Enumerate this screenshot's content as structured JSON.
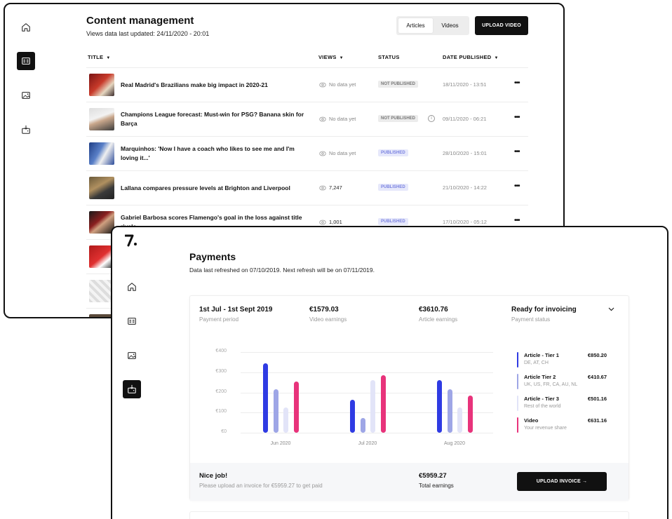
{
  "content_management": {
    "title": "Content management",
    "last_updated": "Views data last updated: 24/11/2020 - 20:01",
    "tabs": [
      "Articles",
      "Videos"
    ],
    "active_tab": "Articles",
    "upload_video_label": "UPLOAD VIDEO",
    "columns": {
      "title": "TITLE",
      "views": "VIEWS",
      "status": "STATUS",
      "date": "DATE PUBLISHED"
    },
    "rows": [
      {
        "title": "Real Madrid's Brazilians make big impact in 2020-21",
        "views": "No data yet",
        "status": "NOT PUBLISHED",
        "date": "18/11/2020 - 13:51"
      },
      {
        "title": "Champions League forecast: Must-win for PSG? Banana skin for Barça",
        "views": "No data yet",
        "status": "NOT PUBLISHED",
        "date": "09/11/2020 - 06:21"
      },
      {
        "title": "Marquinhos: 'Now I have a coach who likes to see me and I'm loving it...'",
        "views": "No data yet",
        "status": "PUBLISHED",
        "date": "28/10/2020 - 15:01"
      },
      {
        "title": "Lallana compares pressure levels at Brighton and Liverpool",
        "views": "7,247",
        "status": "PUBLISHED",
        "date": "21/10/2020 - 14:22"
      },
      {
        "title": "Gabriel Barbosa scores Flamengo's goal in the loss against title rivals",
        "views": "1,001",
        "status": "PUBLISHED",
        "date": "17/10/2020 - 05:12"
      }
    ],
    "more_icon": "more-horizontal-icon"
  },
  "payments": {
    "logo": "7",
    "title": "Payments",
    "subtitle": "Data last refreshed on 07/10/2019. Next refresh will be on 07/11/2019.",
    "summary": [
      {
        "value": "1st Jul - 1st Sept 2019",
        "label": "Payment period"
      },
      {
        "value": "€1579.03",
        "label": "Video earnings"
      },
      {
        "value": "€3610.76",
        "label": "Article earnings"
      },
      {
        "value": "Ready for invoicing",
        "label": "Payment status"
      }
    ],
    "legend": [
      {
        "name": "Article - Tier 1",
        "sub": "DE, AT, CH",
        "amount": "€850.20"
      },
      {
        "name": "Article Tier 2",
        "sub": "UK, US, FR, CA, AU, NL",
        "amount": "€410.67"
      },
      {
        "name": "Article - Tier 3",
        "sub": "Rest of the world",
        "amount": "€501.16"
      },
      {
        "name": "Video",
        "sub": "Your revenue share",
        "amount": "€631.16"
      }
    ],
    "footer": {
      "heading": "Nice job!",
      "message": "Please upload an invoice for €5959.27 to get paid",
      "total": "€5959.27",
      "total_label": "Total earnings",
      "button": "UPLOAD INVOICE →"
    }
  },
  "chart_data": {
    "type": "bar",
    "categories": [
      "Jun 2020",
      "Jul 2020",
      "Aug 2020"
    ],
    "series": [
      {
        "name": "Article - Tier 1",
        "color": "#2f3be3",
        "values": [
          345,
          165,
          262
        ]
      },
      {
        "name": "Article Tier 2",
        "color": "#9ea6e6",
        "values": [
          215,
          72,
          215
        ]
      },
      {
        "name": "Article - Tier 3",
        "color": "#e2e4f8",
        "values": [
          125,
          262,
          125
        ]
      },
      {
        "name": "Video",
        "color": "#e8337b",
        "values": [
          255,
          285,
          185
        ]
      }
    ],
    "yticks": [
      "€400",
      "€300",
      "€200",
      "€100",
      "€0"
    ],
    "ylim": [
      0,
      400
    ],
    "grid": true,
    "legend_position": "right"
  },
  "icons": {
    "home": "home-icon",
    "articles": "articles-icon",
    "media": "image-icon",
    "payments": "wallet-download-icon",
    "views": "eye-icon",
    "info": "info-icon",
    "chevron": "chevron-down-icon"
  }
}
